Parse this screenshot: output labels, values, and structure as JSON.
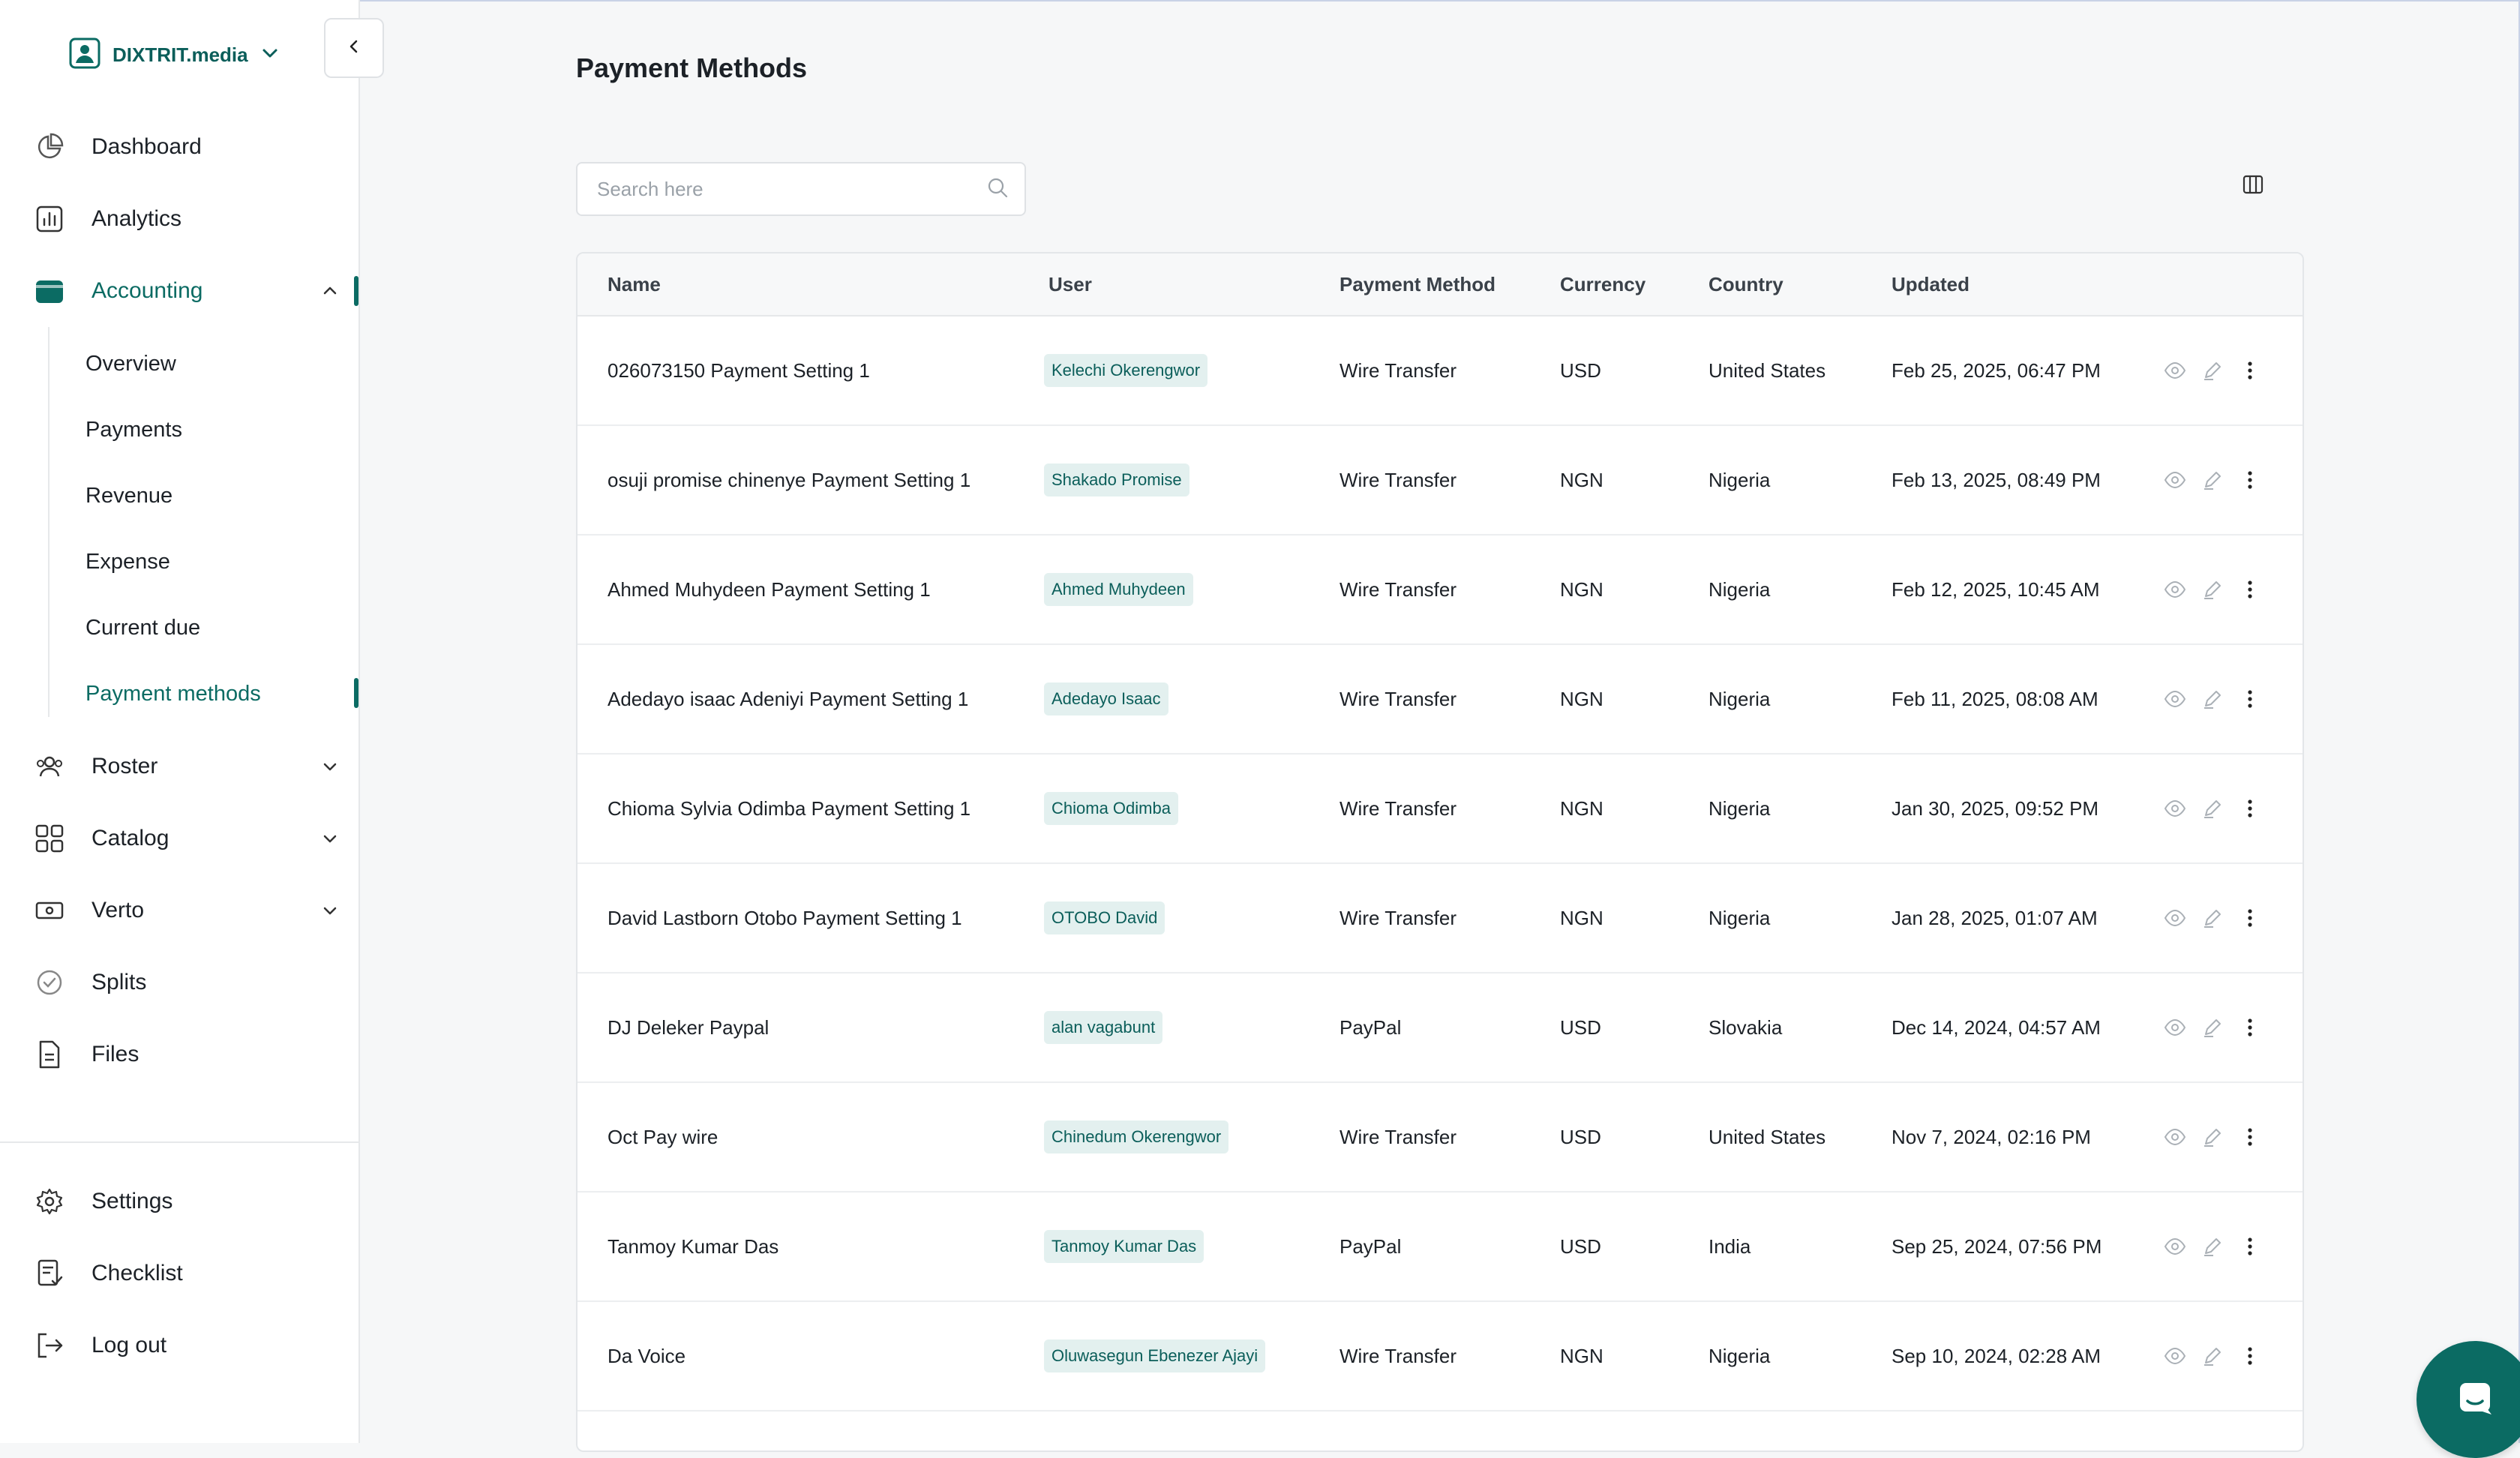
{
  "org": {
    "name": "DIXTRIT.media"
  },
  "nav": {
    "dashboard": "Dashboard",
    "analytics": "Analytics",
    "accounting": "Accounting",
    "accounting_sub": {
      "overview": "Overview",
      "payments": "Payments",
      "revenue": "Revenue",
      "expense": "Expense",
      "current_due": "Current due",
      "payment_methods": "Payment methods"
    },
    "roster": "Roster",
    "catalog": "Catalog",
    "verto": "Verto",
    "splits": "Splits",
    "files": "Files",
    "settings": "Settings",
    "checklist": "Checklist",
    "logout": "Log out"
  },
  "page": {
    "title": "Payment Methods"
  },
  "search": {
    "placeholder": "Search here"
  },
  "table": {
    "columns": {
      "name": "Name",
      "user": "User",
      "payment_method": "Payment Method",
      "currency": "Currency",
      "country": "Country",
      "updated": "Updated"
    },
    "rows": [
      {
        "name": "026073150 Payment Setting 1",
        "user": "Kelechi Okerengwor",
        "method": "Wire Transfer",
        "currency": "USD",
        "country": "United States",
        "updated": "Feb 25, 2025, 06:47 PM"
      },
      {
        "name": "osuji promise chinenye Payment Setting 1",
        "user": "Shakado Promise",
        "method": "Wire Transfer",
        "currency": "NGN",
        "country": "Nigeria",
        "updated": "Feb 13, 2025, 08:49 PM"
      },
      {
        "name": "Ahmed Muhydeen Payment Setting 1",
        "user": "Ahmed Muhydeen",
        "method": "Wire Transfer",
        "currency": "NGN",
        "country": "Nigeria",
        "updated": "Feb 12, 2025, 10:45 AM"
      },
      {
        "name": "Adedayo isaac Adeniyi Payment Setting 1",
        "user": "Adedayo Isaac",
        "method": "Wire Transfer",
        "currency": "NGN",
        "country": "Nigeria",
        "updated": "Feb 11, 2025, 08:08 AM"
      },
      {
        "name": "Chioma Sylvia Odimba Payment Setting 1",
        "user": "Chioma Odimba",
        "method": "Wire Transfer",
        "currency": "NGN",
        "country": "Nigeria",
        "updated": "Jan 30, 2025, 09:52 PM"
      },
      {
        "name": "David Lastborn Otobo Payment Setting 1",
        "user": "OTOBO David",
        "method": "Wire Transfer",
        "currency": "NGN",
        "country": "Nigeria",
        "updated": "Jan 28, 2025, 01:07 AM"
      },
      {
        "name": "DJ Deleker Paypal",
        "user": "alan vagabunt",
        "method": "PayPal",
        "currency": "USD",
        "country": "Slovakia",
        "updated": "Dec 14, 2024, 04:57 AM"
      },
      {
        "name": "Oct Pay wire",
        "user": "Chinedum Okerengwor",
        "method": "Wire Transfer",
        "currency": "USD",
        "country": "United States",
        "updated": "Nov 7, 2024, 02:16 PM"
      },
      {
        "name": "Tanmoy Kumar Das",
        "user": "Tanmoy Kumar Das",
        "method": "PayPal",
        "currency": "USD",
        "country": "India",
        "updated": "Sep 25, 2024, 07:56 PM"
      },
      {
        "name": "Da Voice",
        "user": "Oluwasegun Ebenezer Ajayi",
        "method": "Wire Transfer",
        "currency": "NGN",
        "country": "Nigeria",
        "updated": "Sep 10, 2024, 02:28 AM"
      }
    ]
  },
  "theme": {
    "accent": "#0b6b63",
    "badge_bg": "#e3f0ef"
  }
}
